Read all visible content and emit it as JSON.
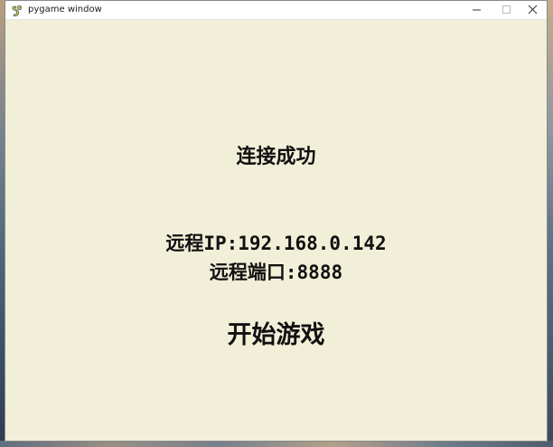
{
  "window": {
    "title": "pygame window",
    "icon": "pygame-snake-icon",
    "background_color": "#f2efd9",
    "controls": {
      "minimize_icon": "minimize-icon",
      "maximize_icon": "maximize-icon",
      "close_icon": "close-icon"
    }
  },
  "screen": {
    "status_text": "连接成功",
    "remote_ip_text": "远程IP:192.168.0.142",
    "remote_port_text": "远程端口:8888",
    "start_game_text": "开始游戏",
    "text_color": "#111111"
  }
}
